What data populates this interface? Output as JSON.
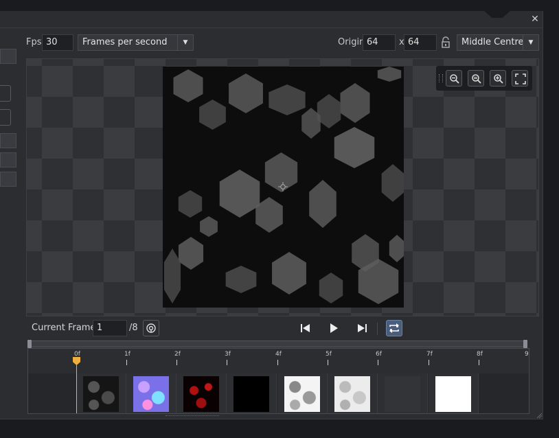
{
  "window": {
    "close_glyph": "✕"
  },
  "toolbar": {
    "fps_label": "Fps",
    "fps_value": "30",
    "fps_mode": "Frames per second",
    "origin_label": "Origin",
    "origin_x": "64",
    "origin_sep": "x",
    "origin_y": "64",
    "origin_preset": "Middle Centre",
    "caret": "▼"
  },
  "zoom_icons": [
    "zoom-out-icon",
    "zoom-reset-icon",
    "zoom-in-icon",
    "fullscreen-icon"
  ],
  "playback": {
    "current_frame_label": "Current Frame:",
    "current_frame_value": "1",
    "total_frames": "/8"
  },
  "timeline": {
    "ticks": [
      "0f",
      "1f",
      "2f",
      "3f",
      "4f",
      "5f",
      "6f",
      "7f",
      "8f",
      "9"
    ],
    "frames": [
      "frame-0",
      "frame-1",
      "frame-2",
      "frame-3",
      "frame-4",
      "frame-5",
      "frame-6",
      "frame-7"
    ]
  },
  "colors": {
    "accent": "#f0b040",
    "active_button": "#4a5d7a",
    "background": "#2c2d31"
  }
}
